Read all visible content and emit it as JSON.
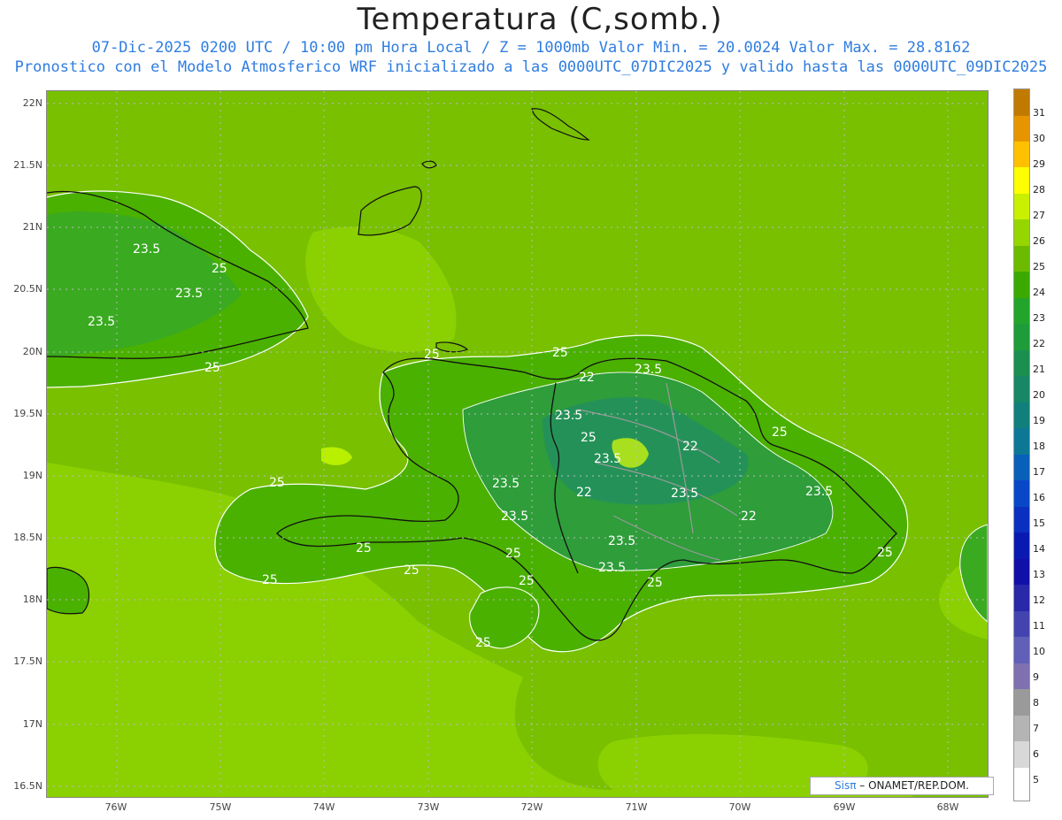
{
  "title": "Temperatura (C,somb.)",
  "subtitle_line1": "07-Dic-2025 0200 UTC / 10:00 pm Hora Local / Z = 1000mb  Valor Min. = 20.0024  Valor Max. = 28.8162",
  "subtitle_line2": "Pronostico con el Modelo Atmosferico WRF inicializado a las 0000UTC_07DIC2025 y valido hasta las  0000UTC_09DIC2025",
  "lat_labels": [
    "22N",
    "21.5N",
    "21N",
    "20.5N",
    "20N",
    "19.5N",
    "19N",
    "18.5N",
    "18N",
    "17.5N",
    "17N",
    "16.5N"
  ],
  "lon_labels": [
    "76W",
    "75W",
    "74W",
    "73W",
    "72W",
    "71W",
    "70W",
    "69W",
    "68W"
  ],
  "legend_values": [
    "31",
    "30",
    "29",
    "28",
    "27",
    "26",
    "25",
    "24",
    "23",
    "22",
    "21",
    "20",
    "19",
    "18",
    "17",
    "16",
    "15",
    "14",
    "13",
    "12",
    "11",
    "10",
    "9",
    "8",
    "7",
    "6",
    "5"
  ],
  "legend_colors": [
    "#c07a00",
    "#e69500",
    "#ffc000",
    "#ffff00",
    "#c8f000",
    "#96d600",
    "#6cbb00",
    "#3aaa00",
    "#22a52a",
    "#1f9c3a",
    "#1a9050",
    "#168866",
    "#11807c",
    "#0c7896",
    "#0860b8",
    "#0848c8",
    "#0a30c0",
    "#0a1ab0",
    "#1010a8",
    "#2828a8",
    "#4444b0",
    "#6060b8",
    "#8070b0",
    "#9a9a9a",
    "#b4b4b4",
    "#d8d8d8",
    "#ffffff"
  ],
  "credit": {
    "sis": "Sisπ",
    "rest": " – ONAMET/REP.DOM."
  },
  "map_colors": {
    "sea_light": "#8bd000",
    "sea_mid": "#78c000",
    "land_25": "#4ab100",
    "land_24": "#3aaa20",
    "land_23": "#2e9d3a",
    "land_22": "#249258",
    "warm_spot": "#a8e020"
  },
  "contour_labels": [
    "23.5",
    "23.5",
    "23.5",
    "25",
    "25",
    "25",
    "25",
    "22",
    "23.5",
    "23.5",
    "25",
    "25",
    "23.5",
    "22",
    "22",
    "23.5",
    "22",
    "23.5",
    "23.5",
    "25",
    "25",
    "25",
    "25",
    "23.5",
    "23.5",
    "25",
    "25",
    "23.5",
    "25",
    "25",
    "25"
  ]
}
